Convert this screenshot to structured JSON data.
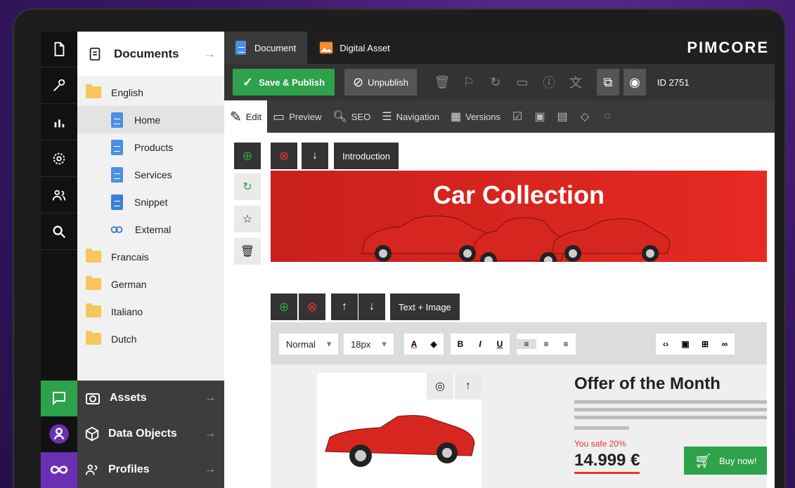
{
  "tree": {
    "header": "Documents",
    "header_arrow": "→",
    "nodes": [
      "English",
      "Home",
      "Products",
      "Services",
      "Snippet",
      "External",
      "Francais",
      "German",
      "Italiano",
      "Dutch"
    ]
  },
  "bottom_panels": [
    {
      "label": "Assets",
      "arrow": "→"
    },
    {
      "label": "Data Objects",
      "arrow": "→"
    },
    {
      "label": "Profiles",
      "arrow": "→"
    }
  ],
  "tabs": [
    {
      "label": "Document"
    },
    {
      "label": "Digital Asset"
    }
  ],
  "logo": "PIMCORE",
  "toolbar": {
    "save_publish": "Save & Publish",
    "unpublish": "Unpublish",
    "id_text": "ID 2751"
  },
  "subtabs": [
    "Edit",
    "Preview",
    "SEO",
    "Navigation",
    "Versions"
  ],
  "editables": {
    "intro_label": "Introduction",
    "text_image_label": "Text + Image",
    "banner_title": "Car Collection"
  },
  "editor": {
    "style_value": "Normal",
    "size_value": "18px",
    "bold": "B",
    "italic": "I",
    "underline": "U"
  },
  "offer": {
    "title": "Offer of the Month",
    "safe_text": "You safe 20%",
    "price": "14.999 €",
    "buy_label": "Buy now!"
  },
  "colors": {
    "accent_green": "#2da24a",
    "banner_red": "#e52a22",
    "dark": "#333333"
  }
}
